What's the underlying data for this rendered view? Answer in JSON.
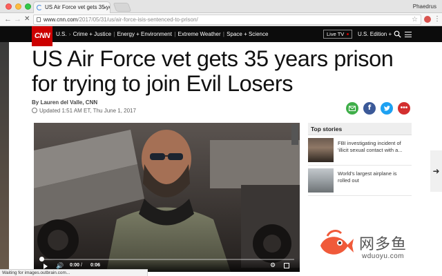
{
  "browser": {
    "tab_title": "US Air Force vet gets 35 year",
    "profile_name": "Phaedrus",
    "url_host": "www.cnn.com",
    "url_path": "/2017/05/31/us/air-force-isis-sentenced-to-prison/",
    "status_text": "Waiting for images.outbrain.com..."
  },
  "cnn": {
    "logo": "CNN",
    "nav_items": [
      "U.S.",
      "Crime + Justice",
      "Energy + Environment",
      "Extreme Weather",
      "Space + Science"
    ],
    "live_tv": "Live TV",
    "edition": "U.S. Edition +",
    "brand_red": "#cc0000"
  },
  "article": {
    "headline": "US Air Force vet gets 35 years prison for trying to join Evil Losers",
    "byline": "By Lauren del Valle, CNN",
    "updated": "Updated 1:51 AM ET, Thu June 1, 2017"
  },
  "video": {
    "current_time": "0:00",
    "separator": "/",
    "duration": "0:06",
    "progress": 0
  },
  "top_stories": {
    "heading": "Top stories",
    "items": [
      {
        "text": "FBI investigating incident of 'illicit sexual contact with a..."
      },
      {
        "text": "World's largest airplane is rolled out"
      }
    ]
  },
  "watermark": {
    "chinese": "网多鱼",
    "url": "wduoyu.com"
  },
  "icons": {
    "email": "envelope-icon",
    "facebook": "facebook-icon",
    "twitter": "twitter-icon",
    "more": "more-icon"
  }
}
